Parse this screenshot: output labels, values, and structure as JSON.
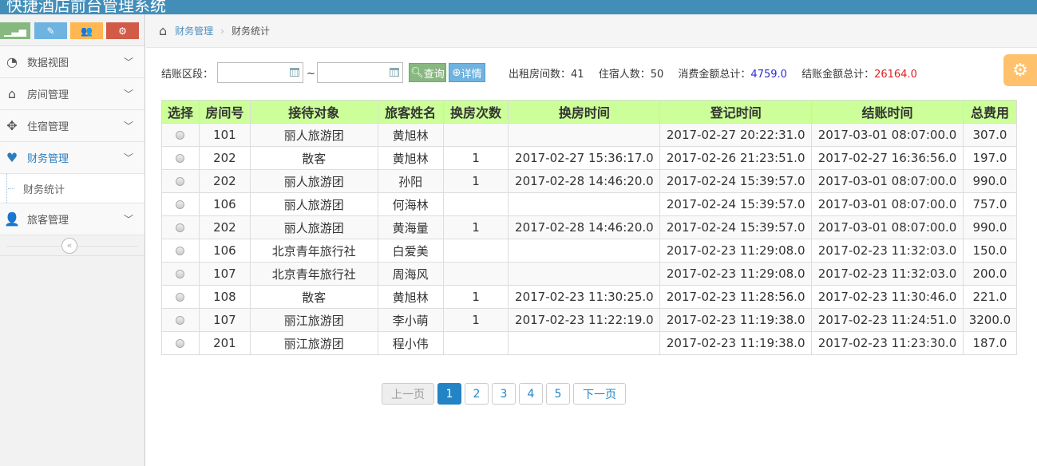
{
  "app": {
    "title": "快捷酒店前台管理系统"
  },
  "sidebar": {
    "shortcuts": [
      {
        "icon": "signal-icon",
        "color": "#87b87f"
      },
      {
        "icon": "pencil-icon",
        "color": "#6fb3e0"
      },
      {
        "icon": "users-icon",
        "color": "#ffb752"
      },
      {
        "icon": "cogs-icon",
        "color": "#d15b47"
      }
    ],
    "items": [
      {
        "label": "数据视图",
        "icon": "dashboard-icon"
      },
      {
        "label": "房间管理",
        "icon": "home-icon"
      },
      {
        "label": "住宿管理",
        "icon": "move-icon"
      },
      {
        "label": "财务管理",
        "icon": "heart-icon",
        "active": true
      },
      {
        "label": "旅客管理",
        "icon": "user-icon"
      }
    ],
    "submenu": {
      "label": "财务统计"
    }
  },
  "breadcrumb": {
    "parent": "财务管理",
    "current": "财务统计"
  },
  "filter": {
    "label": "结账区段：",
    "start_value": "",
    "end_value": "",
    "separator": "~",
    "query_button": "查询",
    "detail_button": "详情"
  },
  "stats": {
    "rooms_label": "出租房间数：",
    "rooms_value": "41",
    "guests_label": "住宿人数：",
    "guests_value": "50",
    "consume_label": "消费金额总计：",
    "consume_value": "4759.0",
    "checkout_label": "结账金额总计：",
    "checkout_value": "26164.0",
    "colors": {
      "consume": "#2c2cd4",
      "checkout": "#e02020"
    }
  },
  "table": {
    "headers": [
      "选择",
      "房间号",
      "接待对象",
      "旅客姓名",
      "换房次数",
      "换房时间",
      "登记时间",
      "结账时间",
      "总费用"
    ],
    "rows": [
      [
        "",
        "101",
        "丽人旅游团",
        "黄旭林",
        "",
        "",
        "2017-02-27 20:22:31.0",
        "2017-03-01 08:07:00.0",
        "307.0"
      ],
      [
        "",
        "202",
        "散客",
        "黄旭林",
        "1",
        "2017-02-27 15:36:17.0",
        "2017-02-26 21:23:51.0",
        "2017-02-27 16:36:56.0",
        "197.0"
      ],
      [
        "",
        "202",
        "丽人旅游团",
        "孙阳",
        "1",
        "2017-02-28 14:46:20.0",
        "2017-02-24 15:39:57.0",
        "2017-03-01 08:07:00.0",
        "990.0"
      ],
      [
        "",
        "106",
        "丽人旅游团",
        "何海林",
        "",
        "",
        "2017-02-24 15:39:57.0",
        "2017-03-01 08:07:00.0",
        "757.0"
      ],
      [
        "",
        "202",
        "丽人旅游团",
        "黄海量",
        "1",
        "2017-02-28 14:46:20.0",
        "2017-02-24 15:39:57.0",
        "2017-03-01 08:07:00.0",
        "990.0"
      ],
      [
        "",
        "106",
        "北京青年旅行社",
        "白爱美",
        "",
        "",
        "2017-02-23 11:29:08.0",
        "2017-02-23 11:32:03.0",
        "150.0"
      ],
      [
        "",
        "107",
        "北京青年旅行社",
        "周海风",
        "",
        "",
        "2017-02-23 11:29:08.0",
        "2017-02-23 11:32:03.0",
        "200.0"
      ],
      [
        "",
        "108",
        "散客",
        "黄旭林",
        "1",
        "2017-02-23 11:30:25.0",
        "2017-02-23 11:28:56.0",
        "2017-02-23 11:30:46.0",
        "221.0"
      ],
      [
        "",
        "107",
        "丽江旅游团",
        "李小萌",
        "1",
        "2017-02-23 11:22:19.0",
        "2017-02-23 11:19:38.0",
        "2017-02-23 11:24:51.0",
        "3200.0"
      ],
      [
        "",
        "201",
        "丽江旅游团",
        "程小伟",
        "",
        "",
        "2017-02-23 11:19:38.0",
        "2017-02-23 11:23:30.0",
        "187.0"
      ]
    ]
  },
  "pagination": {
    "prev": "上一页",
    "pages": [
      "1",
      "2",
      "3",
      "4",
      "5"
    ],
    "active_page": "1",
    "next": "下一页"
  }
}
